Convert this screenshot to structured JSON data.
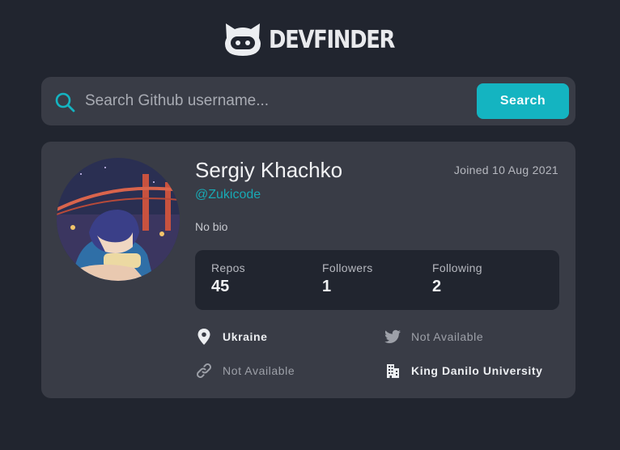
{
  "header": {
    "logo_icon": "cat-head-icon",
    "title": "DEVFINDER"
  },
  "search": {
    "icon": "search-icon",
    "placeholder": "Search Github username...",
    "value": "",
    "button_label": "Search"
  },
  "profile": {
    "avatar": "anime-avatar-image",
    "name": "Sergiy Khachko",
    "username": "@Zukicode",
    "joined": "Joined 10 Aug 2021",
    "bio": "No bio",
    "stats": {
      "repos": {
        "label": "Repos",
        "value": "45"
      },
      "followers": {
        "label": "Followers",
        "value": "1"
      },
      "following": {
        "label": "Following",
        "value": "2"
      }
    },
    "links": {
      "location": {
        "icon": "location-pin-icon",
        "text": "Ukraine"
      },
      "twitter": {
        "icon": "twitter-icon",
        "text": "Not Available"
      },
      "blog": {
        "icon": "link-icon",
        "text": "Not Available"
      },
      "company": {
        "icon": "building-icon",
        "text": "King Danilo University"
      }
    }
  },
  "colors": {
    "background": "#21252f",
    "surface": "#393c46",
    "accent": "#14b4c1",
    "username": "#18a9b4",
    "text_primary": "#f1f2f4",
    "text_muted": "#9da0a8"
  }
}
